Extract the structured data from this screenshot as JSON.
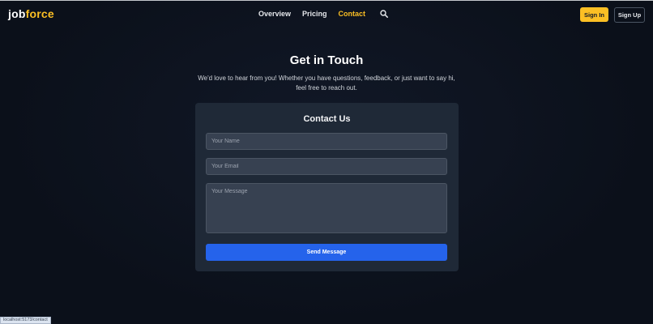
{
  "brand": {
    "logo_part1": "job",
    "logo_part2": "force",
    "accent_color": "#fbbf24"
  },
  "nav": {
    "links": [
      {
        "label": "Overview"
      },
      {
        "label": "Pricing"
      },
      {
        "label": "Contact",
        "active": true
      }
    ],
    "search_icon": "search-icon",
    "signin_label": "Sign In",
    "signup_label": "Sign Up"
  },
  "hero": {
    "title": "Get in Touch",
    "subtitle": "We'd love to hear from you! Whether you have questions, feedback, or just want to say hi, feel free to reach out."
  },
  "form": {
    "title": "Contact Us",
    "name_placeholder": "Your Name",
    "email_placeholder": "Your Email",
    "message_placeholder": "Your Message",
    "submit_label": "Send Message",
    "submit_color": "#2563eb"
  },
  "status": {
    "url": "localhost:5173/contact"
  }
}
